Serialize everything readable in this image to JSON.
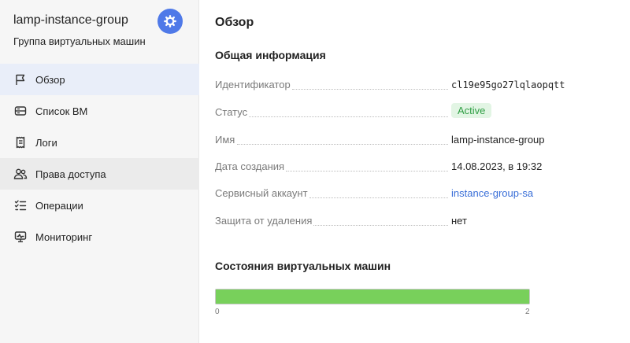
{
  "sidebar": {
    "title": "lamp-instance-group",
    "subtitle": "Группа виртуальных машин",
    "badge_icon": "gear-icon",
    "items": [
      {
        "label": "Обзор",
        "icon": "flag-icon",
        "state": "active"
      },
      {
        "label": "Список ВМ",
        "icon": "list-icon",
        "state": ""
      },
      {
        "label": "Логи",
        "icon": "logs-icon",
        "state": ""
      },
      {
        "label": "Права доступа",
        "icon": "users-icon",
        "state": "hover"
      },
      {
        "label": "Операции",
        "icon": "operations-icon",
        "state": ""
      },
      {
        "label": "Мониторинг",
        "icon": "monitoring-icon",
        "state": ""
      }
    ]
  },
  "main": {
    "title": "Обзор",
    "general_title": "Общая информация",
    "info": [
      {
        "key": "Идентификатор",
        "value": "cl19e95go27lqlaopqtt",
        "style": "mono"
      },
      {
        "key": "Статус",
        "value": "Active",
        "style": "badge"
      },
      {
        "key": "Имя",
        "value": "lamp-instance-group",
        "style": ""
      },
      {
        "key": "Дата создания",
        "value": "14.08.2023, в 19:32",
        "style": ""
      },
      {
        "key": "Сервисный аккаунт",
        "value": "instance-group-sa",
        "style": "link"
      },
      {
        "key": "Защита от удаления",
        "value": "нет",
        "style": ""
      }
    ],
    "vm_states_title": "Состояния виртуальных машин",
    "vm_bar": {
      "min": "0",
      "max": "2",
      "fill_fraction": 1.0,
      "color": "#78d05b"
    }
  },
  "colors": {
    "accent": "#4f79e8",
    "link": "#3a6fd8",
    "status_active": "#2f9e44",
    "bar": "#78d05b"
  }
}
